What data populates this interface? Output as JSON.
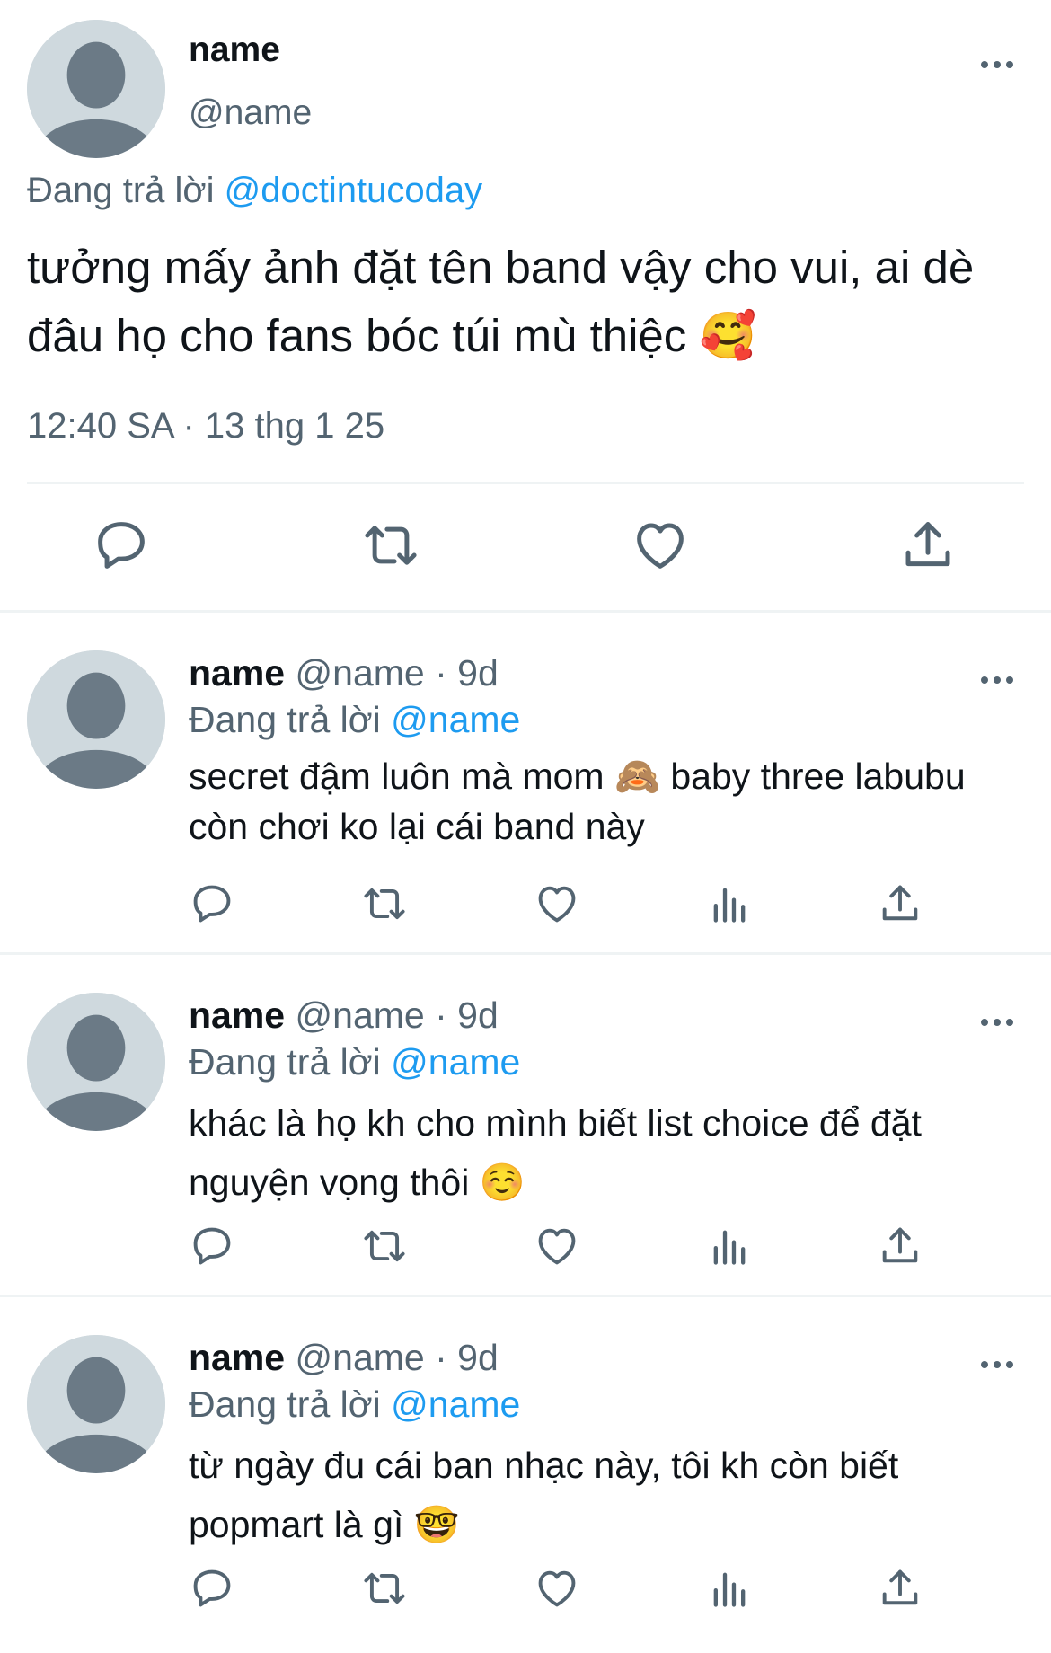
{
  "colors": {
    "accent": "#1d9bf0",
    "muted": "#536471",
    "text": "#0f1419",
    "avatar_bg": "#cfd9de",
    "avatar_fg": "#6b7a86"
  },
  "icons": {
    "more": "more-horizontal-icon",
    "reply": "reply-icon",
    "retweet": "retweet-icon",
    "like": "like-icon",
    "views": "views-icon",
    "share": "share-icon"
  },
  "main_tweet": {
    "name": "name",
    "handle": "@name",
    "replying_prefix": "Đang trả lời ",
    "replying_to": "@doctintucoday",
    "text": "tưởng mấy ảnh đặt tên band vậy cho vui, ai dè đâu họ cho fans bóc túi mù thiệc 🥰",
    "time": "12:40 SA",
    "separator": " · ",
    "date": "13 thg 1 25"
  },
  "replies": [
    {
      "name": "name",
      "handle": "@name",
      "dot": " · ",
      "time": "9d",
      "replying_prefix": "Đang trả lời ",
      "replying_to": "@name",
      "text": "secret đậm luôn mà mom 🙈  baby three labubu còn chơi ko lại cái band này"
    },
    {
      "name": "name",
      "handle": "@name",
      "dot": " · ",
      "time": "9d",
      "replying_prefix": "Đang trả lời ",
      "replying_to": "@name",
      "text": "khác là họ kh cho mình biết list choice để đặt nguyện vọng thôi ☺️"
    },
    {
      "name": "name",
      "handle": "@name",
      "dot": " · ",
      "time": "9d",
      "replying_prefix": "Đang trả lời ",
      "replying_to": "@name",
      "text": "từ ngày đu cái ban nhạc này, tôi kh còn biết popmart là gì 🤓"
    }
  ]
}
